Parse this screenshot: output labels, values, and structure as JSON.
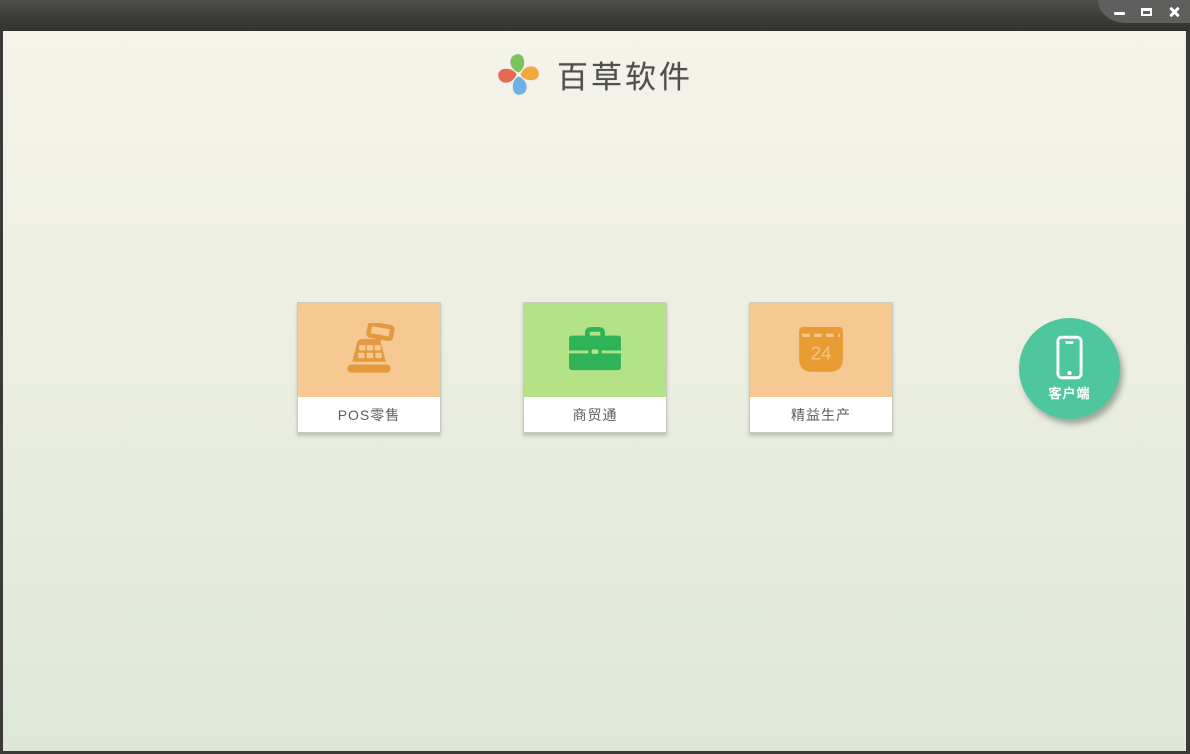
{
  "window": {
    "title": "",
    "controls": {
      "minimize": "minimize",
      "maximize": "maximize",
      "close": "close"
    },
    "titlebar_colors": {
      "top": "#4d4d4b",
      "bottom": "#323230",
      "controls_tab": "#5f5f5d"
    },
    "border_color": "#3a3a38"
  },
  "header": {
    "app_title": "百草软件",
    "logo": {
      "icon": "pinwheel-logo-icon",
      "petal_colors": {
        "top": "#7cc460",
        "right": "#f2a93b",
        "bottom": "#6db1e8",
        "left": "#e46a52"
      }
    }
  },
  "content": {
    "background_top": "#f5f3ea",
    "background_bottom": "#dde7d8"
  },
  "products": [
    {
      "label": "POS零售",
      "icon": "cash-register-icon",
      "tile_color": "#f6c993",
      "icon_color": "#e5993f"
    },
    {
      "label": "商贸通",
      "icon": "briefcase-icon",
      "tile_color": "#b4e287",
      "icon_color": "#2eb359"
    },
    {
      "label": "精益生产",
      "icon": "calendar-icon",
      "tile_color": "#f6c993",
      "icon_color": "#e89d33",
      "calendar_day": "24"
    }
  ],
  "client_button": {
    "label": "客户端",
    "icon": "smartphone-icon",
    "color": "#4ec79e"
  }
}
